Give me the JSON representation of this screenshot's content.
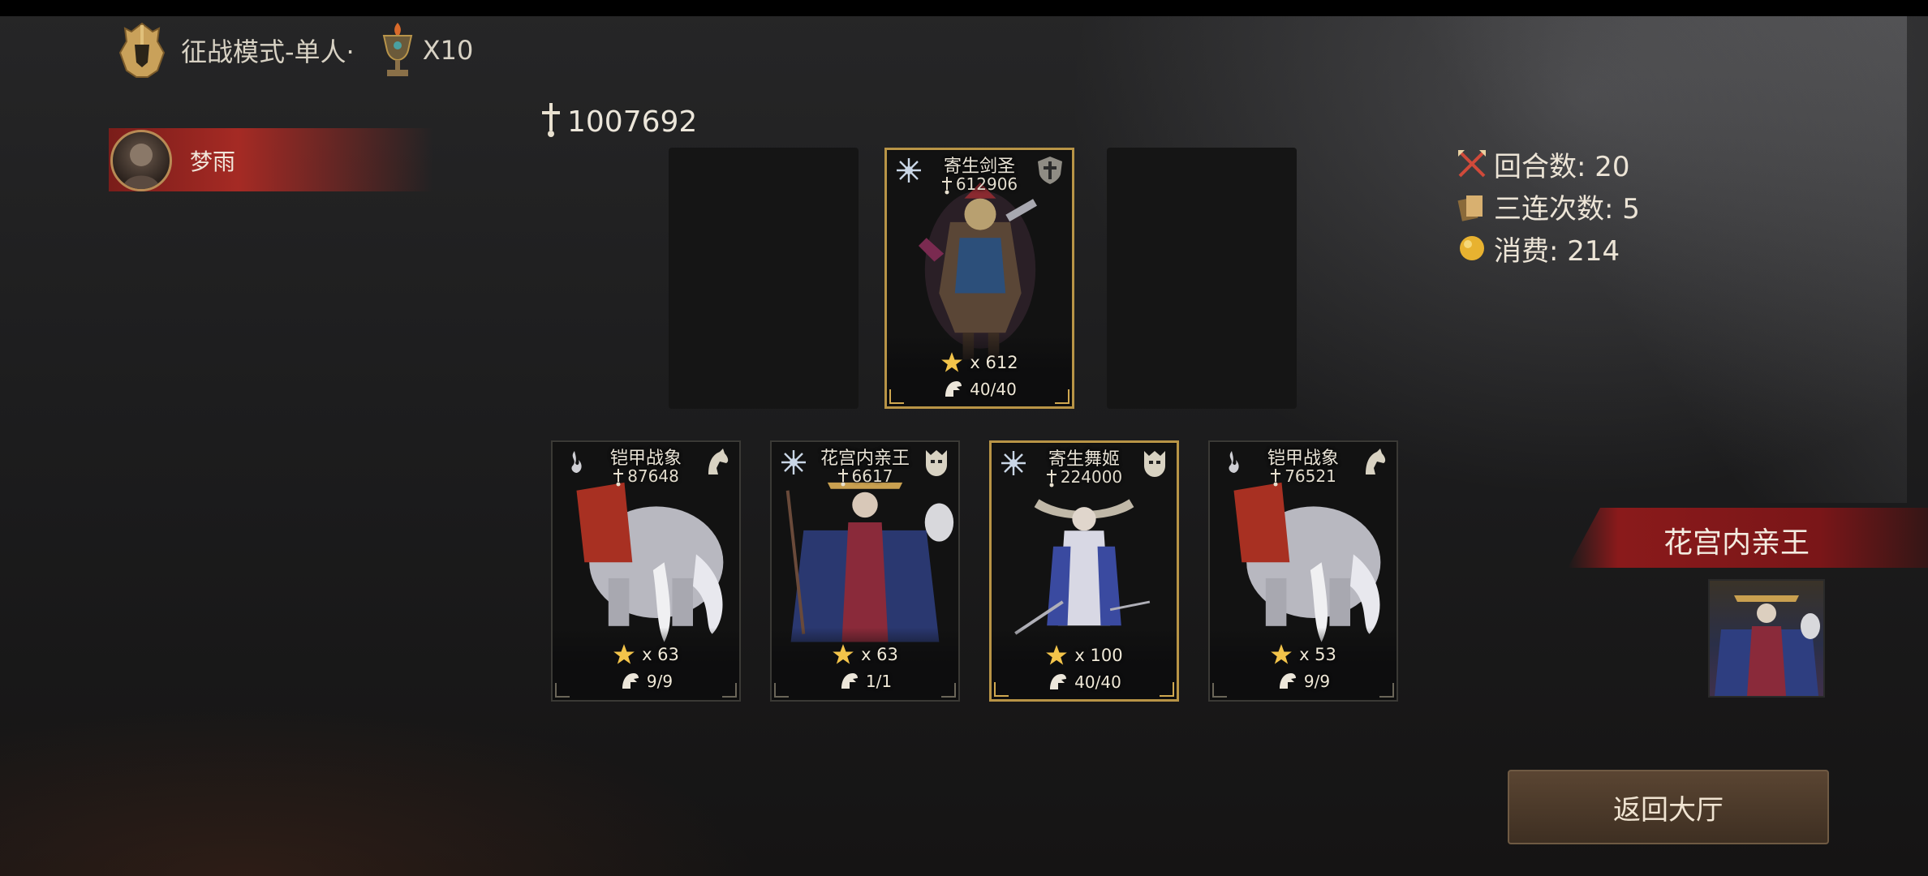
{
  "header": {
    "mode_label": "征战模式-单人·",
    "trophy_count": "X10"
  },
  "player": {
    "name": "梦雨"
  },
  "team_power": "1007692",
  "cards_top": [
    {
      "name": "寄生剑圣",
      "power": "612906",
      "stars": "x 612",
      "level": "40/40",
      "icon_left": "snowflake-sigil-icon",
      "icon_right": "shield-class-icon",
      "frame": "gold"
    }
  ],
  "cards_bottom": [
    {
      "name": "铠甲战象",
      "power": "87648",
      "stars": "x 63",
      "level": "9/9",
      "icon_left": "flame-sigil-icon",
      "icon_right": "horse-class-icon",
      "frame": "plain"
    },
    {
      "name": "花宫内亲王",
      "power": "6617",
      "stars": "x 63",
      "level": "1/1",
      "icon_left": "snowflake-sigil-icon",
      "icon_right": "mask-class-icon",
      "frame": "plain"
    },
    {
      "name": "寄生舞姬",
      "power": "224000",
      "stars": "x 100",
      "level": "40/40",
      "icon_left": "snowflake-sigil-icon",
      "icon_right": "mask-class-icon",
      "frame": "gold"
    },
    {
      "name": "铠甲战象",
      "power": "76521",
      "stars": "x 53",
      "level": "9/9",
      "icon_left": "flame-sigil-icon",
      "icon_right": "horse-class-icon",
      "frame": "plain"
    }
  ],
  "stats": {
    "rounds": "回合数: 20",
    "triples": "三连次数: 5",
    "cost": "消费: 214"
  },
  "boss": {
    "name": "花宫内亲王"
  },
  "buttons": {
    "back": "返回大厅"
  },
  "colors": {
    "accent_gold": "#b89446",
    "banner_red": "#8a1a1b",
    "button_brown": "#4a382a"
  }
}
